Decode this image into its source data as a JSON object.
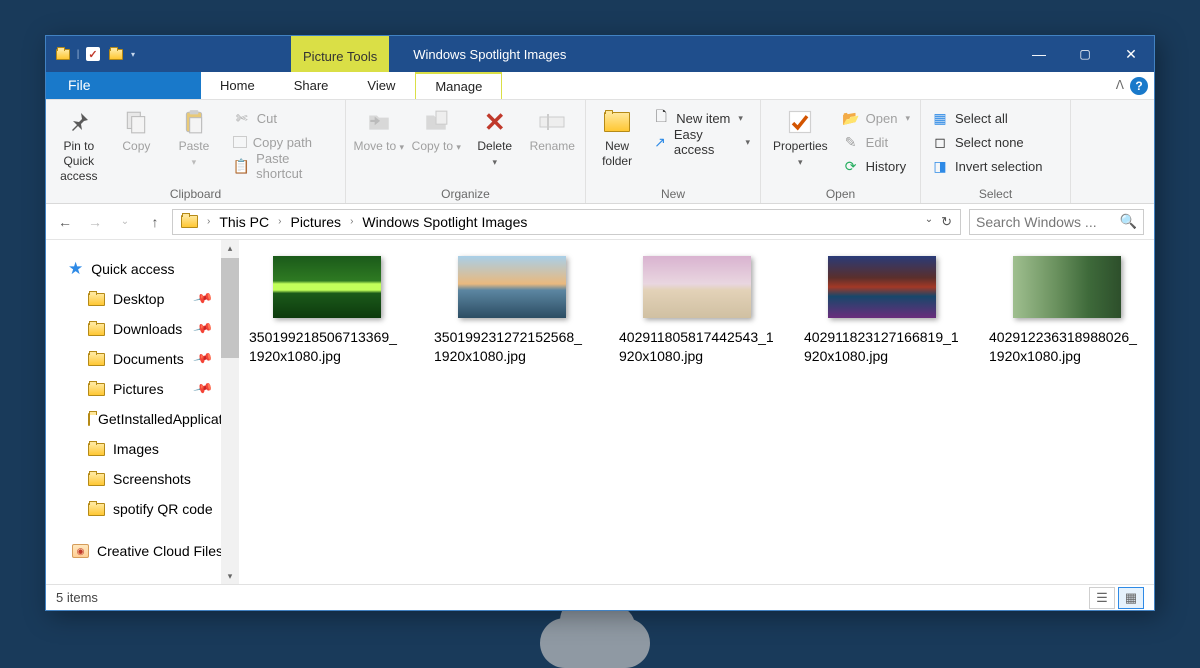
{
  "titlebar": {
    "context_tab": "Picture Tools",
    "title": "Windows Spotlight Images",
    "min": "—",
    "max": "▢",
    "close": "✕"
  },
  "tabs": {
    "file": "File",
    "home": "Home",
    "share": "Share",
    "view": "View",
    "manage": "Manage"
  },
  "ribbon": {
    "clipboard": {
      "label": "Clipboard",
      "pin": "Pin to Quick access",
      "copy": "Copy",
      "paste": "Paste",
      "cut": "Cut",
      "copy_path": "Copy path",
      "paste_shortcut": "Paste shortcut"
    },
    "organize": {
      "label": "Organize",
      "move_to": "Move to",
      "copy_to": "Copy to",
      "delete": "Delete",
      "rename": "Rename"
    },
    "new": {
      "label": "New",
      "new_folder": "New folder",
      "new_item": "New item",
      "easy_access": "Easy access"
    },
    "open": {
      "label": "Open",
      "properties": "Properties",
      "open": "Open",
      "edit": "Edit",
      "history": "History"
    },
    "select": {
      "label": "Select",
      "select_all": "Select all",
      "select_none": "Select none",
      "invert": "Invert selection"
    }
  },
  "address": {
    "crumbs": [
      "This PC",
      "Pictures",
      "Windows Spotlight Images"
    ]
  },
  "search": {
    "placeholder": "Search Windows ..."
  },
  "nav": {
    "quick_access": "Quick access",
    "items": [
      {
        "label": "Desktop",
        "pinned": true
      },
      {
        "label": "Downloads",
        "pinned": true
      },
      {
        "label": "Documents",
        "pinned": true
      },
      {
        "label": "Pictures",
        "pinned": true
      },
      {
        "label": "GetInstalledApplicationInfo",
        "pinned": false
      },
      {
        "label": "Images",
        "pinned": false
      },
      {
        "label": "Screenshots",
        "pinned": false
      },
      {
        "label": "spotify QR code",
        "pinned": false
      }
    ],
    "creative_cloud": "Creative Cloud Files"
  },
  "files": [
    {
      "name": "35019921850671\n3369_1920x1080.jpg",
      "thumb": "th1"
    },
    {
      "name": "35019923127215\n2568_1920x1080.jpg",
      "thumb": "th2"
    },
    {
      "name": "40291180581744\n2543_1920x1080.jpg",
      "thumb": "th3"
    },
    {
      "name": "40291182312716\n6819_1920x1080.jpg",
      "thumb": "th4"
    },
    {
      "name": "40291223631898\n8026_1920x1080.jpg",
      "thumb": "th5"
    }
  ],
  "status": {
    "count": "5 items"
  }
}
